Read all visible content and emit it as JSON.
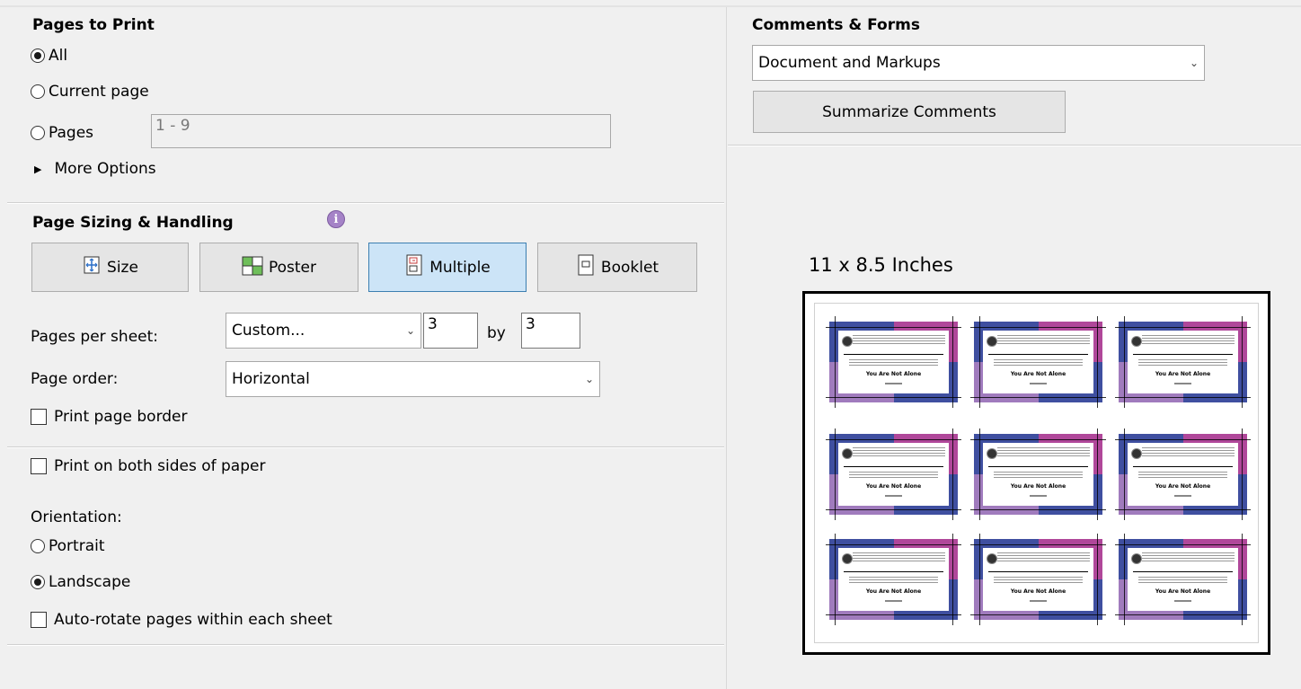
{
  "pages_to_print": {
    "title": "Pages to Print",
    "options": [
      {
        "label": "All",
        "selected": true
      },
      {
        "label": "Current page",
        "selected": false
      },
      {
        "label": "Pages",
        "selected": false
      }
    ],
    "pages_value": "1 - 9",
    "more_options": "More Options"
  },
  "page_sizing": {
    "title": "Page Sizing & Handling",
    "buttons": {
      "size": "Size",
      "poster": "Poster",
      "multiple": "Multiple",
      "booklet": "Booklet"
    },
    "selected_button": "Multiple",
    "pages_per_sheet_label": "Pages per sheet:",
    "pages_per_sheet_value": "Custom...",
    "cols": "3",
    "by_label": "by",
    "rows": "3",
    "page_order_label": "Page order:",
    "page_order_value": "Horizontal",
    "print_page_border": "Print page border"
  },
  "duplex": {
    "both_sides": "Print on both sides of paper"
  },
  "orientation": {
    "label": "Orientation:",
    "options": [
      {
        "label": "Portrait",
        "selected": false
      },
      {
        "label": "Landscape",
        "selected": true
      }
    ],
    "auto_rotate": "Auto-rotate pages within each sheet"
  },
  "comments_forms": {
    "title": "Comments & Forms",
    "value": "Document and Markups",
    "summarize": "Summarize Comments"
  },
  "preview": {
    "size_label": "11 x 8.5 Inches",
    "card": {
      "big_text": "You Are Not Alone"
    }
  },
  "colors": {
    "blue": "#3f4fa0",
    "magenta": "#b0479a",
    "lavender": "#a07bbd",
    "selected_button": "#cce4f7"
  }
}
